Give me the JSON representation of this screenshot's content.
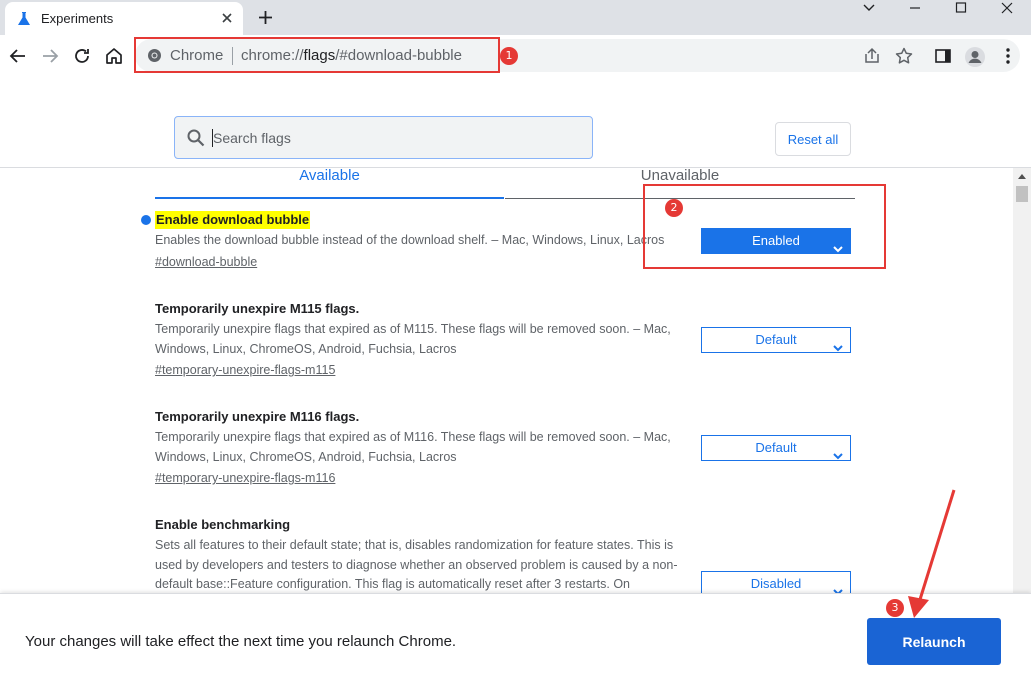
{
  "tab": {
    "title": "Experiments"
  },
  "omnibox": {
    "site_label": "Chrome",
    "url_prefix": "chrome://",
    "url_host": "flags",
    "url_rest": "/#download-bubble"
  },
  "search": {
    "placeholder": "Search flags"
  },
  "header": {
    "reset_label": "Reset all"
  },
  "tabs": {
    "available": "Available",
    "unavailable": "Unavailable"
  },
  "flags": [
    {
      "name": "Enable download bubble",
      "description": "Enables the download bubble instead of the download shelf. – Mac, Windows, Linux, Lacros",
      "link": "#download-bubble",
      "value": "Enabled"
    },
    {
      "name": "Temporarily unexpire M115 flags.",
      "description": "Temporarily unexpire flags that expired as of M115. These flags will be removed soon. – Mac, Windows, Linux, ChromeOS, Android, Fuchsia, Lacros",
      "link": "#temporary-unexpire-flags-m115",
      "value": "Default"
    },
    {
      "name": "Temporarily unexpire M116 flags.",
      "description": "Temporarily unexpire flags that expired as of M116. These flags will be removed soon. – Mac, Windows, Linux, ChromeOS, Android, Fuchsia, Lacros",
      "link": "#temporary-unexpire-flags-m116",
      "value": "Default"
    },
    {
      "name": "Enable benchmarking",
      "description": "Sets all features to their default state; that is, disables randomization for feature states. This is used by developers and testers to diagnose whether an observed problem is caused by a non-default base::Feature configuration. This flag is automatically reset after 3 restarts. On",
      "link": "",
      "value": "Disabled"
    }
  ],
  "relaunch": {
    "message": "Your changes will take effect the next time you relaunch Chrome.",
    "button": "Relaunch"
  },
  "annotations": {
    "badge1": "1",
    "badge2": "2",
    "badge3": "3"
  },
  "colors": {
    "accent": "#1a73e8",
    "annotation": "#e53935",
    "highlight": "#ffff00"
  }
}
